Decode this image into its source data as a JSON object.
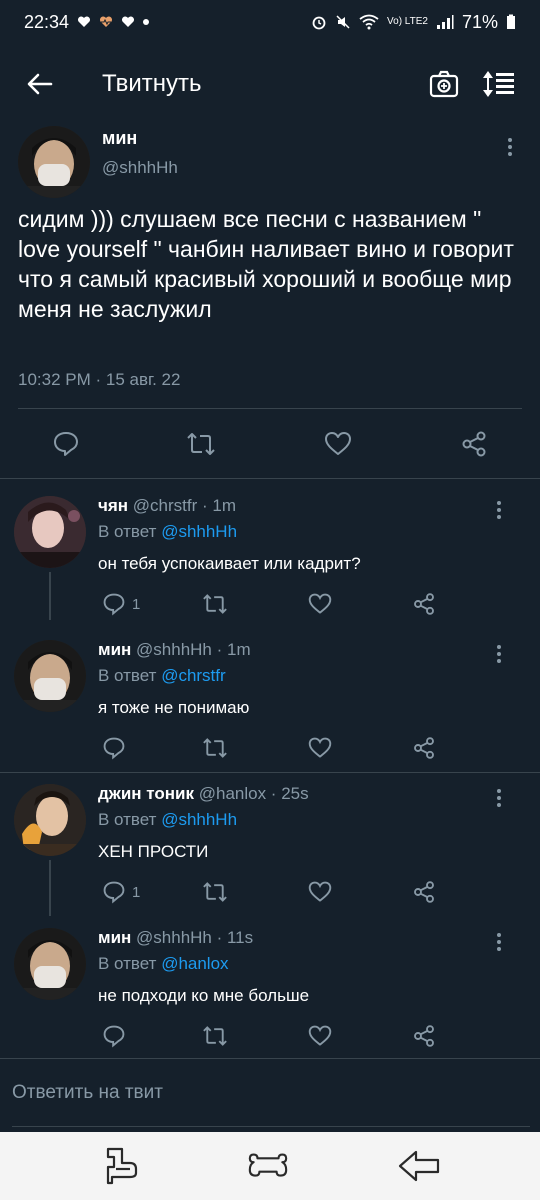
{
  "status_bar": {
    "time": "22:34",
    "volte": "Vo) LTE2",
    "battery": "71%"
  },
  "header": {
    "title": "Твитнуть"
  },
  "main_tweet": {
    "name": "мин",
    "handle": "@shhhHh",
    "text": "сидим ))) слушаем все песни с названием \" love yourself \" чанбин наливает вино и говорит что я самый красивый хороший и вообще мир меня не заслужил",
    "time": "10:32 PM · 15 авг. 22"
  },
  "replies": [
    {
      "name": "чян",
      "handle": "@chrstfr · 1m",
      "reply_prefix": "В ответ",
      "reply_to": "@shhhHh",
      "text": "он тебя успокаивает или кадрит?",
      "reply_count": "1"
    },
    {
      "name": "мин",
      "handle": "@shhhHh · 1m",
      "reply_prefix": "В ответ",
      "reply_to": "@chrstfr",
      "text": "я тоже не понимаю",
      "reply_count": ""
    },
    {
      "name": "джин тоник",
      "handle": "@hanlox · 25s",
      "reply_prefix": "В ответ",
      "reply_to": "@shhhHh",
      "text": "ХЕН ПРОСТИ",
      "reply_count": "1"
    },
    {
      "name": "мин",
      "handle": "@shhhHh · 11s",
      "reply_prefix": "В ответ",
      "reply_to": "@hanlox",
      "text": "не подходи ко мне больше",
      "reply_count": ""
    }
  ],
  "compose": {
    "placeholder": "Ответить на твит"
  },
  "colors": {
    "background": "#15202b",
    "link": "#1d9bf0",
    "muted": "#8899a6",
    "divider": "#38444d"
  },
  "icons": [
    "back-arrow-icon",
    "camera-icon",
    "sort-icon",
    "more-vertical-icon",
    "reply-icon",
    "retweet-icon",
    "like-icon",
    "share-icon",
    "recents-icon",
    "home-icon",
    "nav-back-icon"
  ]
}
